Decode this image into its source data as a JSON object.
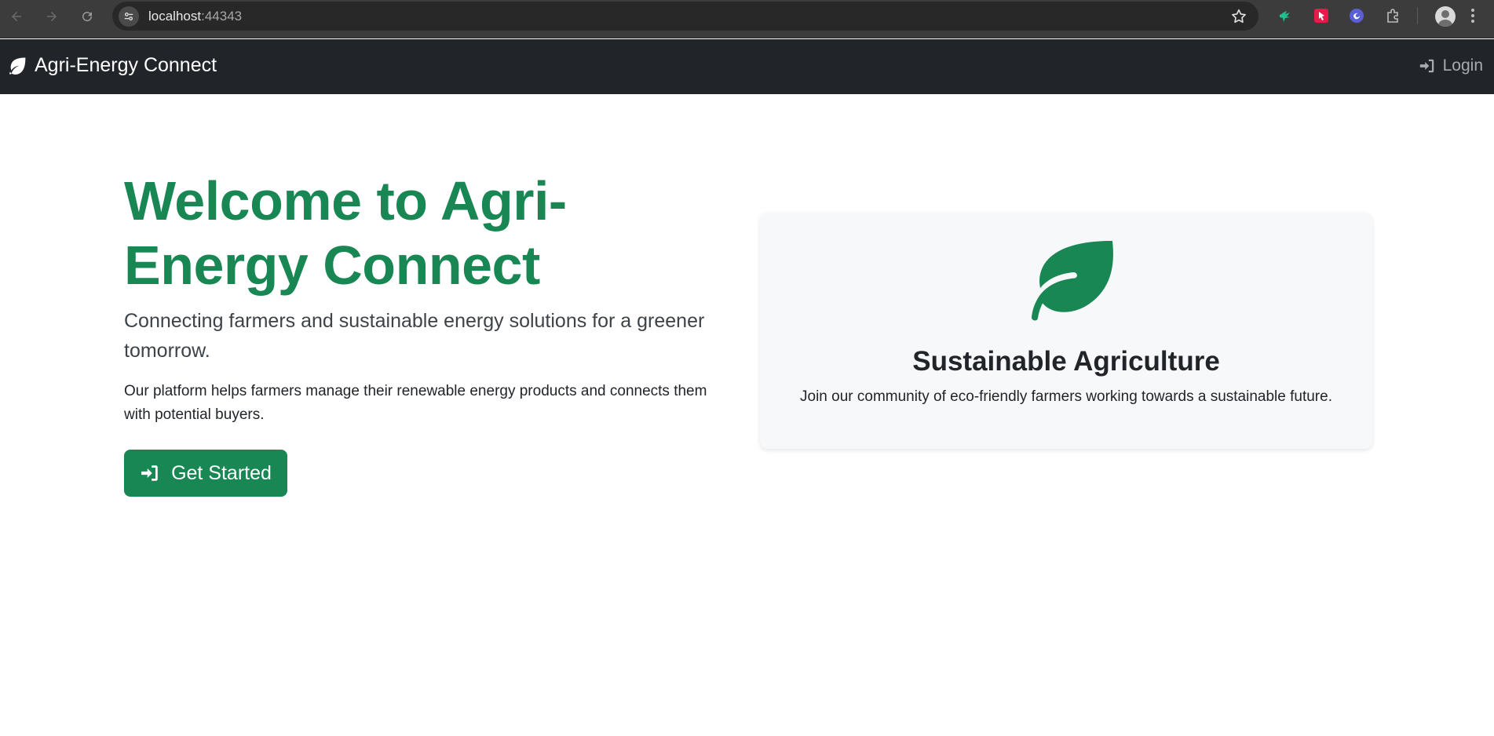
{
  "browser": {
    "url_host": "localhost",
    "url_port": ":44343"
  },
  "navbar": {
    "brand": "Agri-Energy Connect",
    "login_label": "Login"
  },
  "hero": {
    "title": "Welcome to Agri-Energy Connect",
    "lead": "Connecting farmers and sustainable energy solutions for a greener tomorrow.",
    "body": "Our platform helps farmers manage their renewable energy products and connects them with potential buyers.",
    "cta_label": "Get Started"
  },
  "card": {
    "title": "Sustainable Agriculture",
    "text": "Join our community of eco-friendly farmers working towards a sustainable future."
  },
  "colors": {
    "primary_green": "#198754",
    "navbar_dark": "#212529",
    "card_bg": "#f7f8f9"
  },
  "icons": {
    "brand": "leaf-icon",
    "login": "sign-in-icon",
    "cta": "sign-in-icon",
    "card": "leaf-icon"
  }
}
